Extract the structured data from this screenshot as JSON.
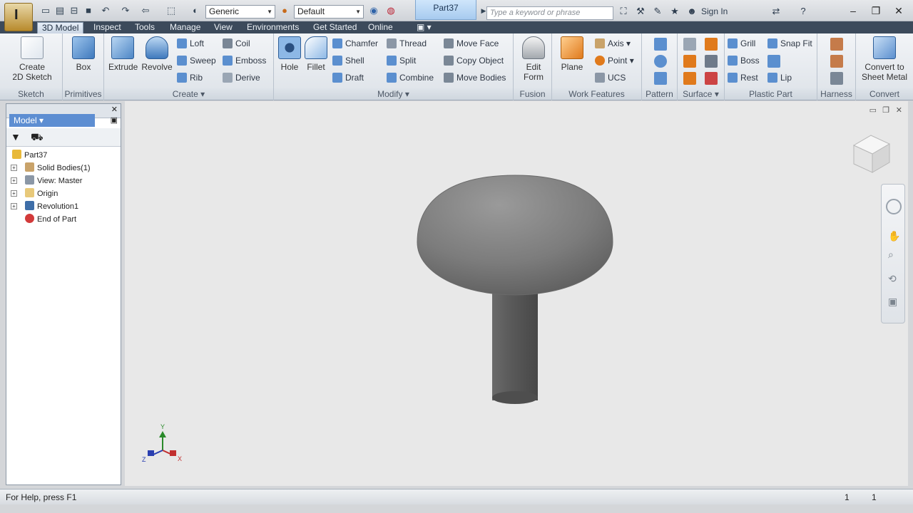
{
  "titlebar": {
    "material_combo": "Generic",
    "appearance_combo": "Default",
    "document_tab": "Part37",
    "search_placeholder": "Type a keyword or phrase",
    "sign_in": "Sign In"
  },
  "tabs": [
    "3D Model",
    "Inspect",
    "Tools",
    "Manage",
    "View",
    "Environments",
    "Get Started",
    "Online"
  ],
  "ribbon": {
    "sketch": {
      "label": "Sketch",
      "create_line1": "Create",
      "create_line2": "2D Sketch"
    },
    "primitives": {
      "label": "Primitives",
      "box": "Box"
    },
    "create": {
      "label": "Create",
      "extrude": "Extrude",
      "revolve": "Revolve",
      "loft": "Loft",
      "sweep": "Sweep",
      "rib": "Rib",
      "coil": "Coil",
      "emboss": "Emboss",
      "derive": "Derive"
    },
    "modify": {
      "label": "Modify",
      "hole": "Hole",
      "fillet": "Fillet",
      "chamfer": "Chamfer",
      "shell": "Shell",
      "draft": "Draft",
      "thread": "Thread",
      "split": "Split",
      "combine": "Combine",
      "move_face": "Move Face",
      "copy_object": "Copy Object",
      "move_bodies": "Move Bodies"
    },
    "fusion": {
      "label": "Fusion",
      "edit_line1": "Edit",
      "edit_line2": "Form"
    },
    "work_features": {
      "label": "Work Features",
      "plane": "Plane",
      "axis": "Axis",
      "point": "Point",
      "ucs": "UCS"
    },
    "pattern": {
      "label": "Pattern"
    },
    "surface": {
      "label": "Surface"
    },
    "plastic_part": {
      "label": "Plastic Part",
      "grill": "Grill",
      "boss": "Boss",
      "rest": "Rest",
      "snap_fit": "Snap Fit",
      "lip": "Lip"
    },
    "harness": {
      "label": "Harness"
    },
    "convert": {
      "label": "Convert",
      "line1": "Convert to",
      "line2": "Sheet Metal"
    }
  },
  "browser": {
    "title": "Model",
    "items": [
      {
        "label": "Part37"
      },
      {
        "label": "Solid Bodies(1)"
      },
      {
        "label": "View: Master"
      },
      {
        "label": "Origin"
      },
      {
        "label": "Revolution1"
      },
      {
        "label": "End of Part"
      }
    ]
  },
  "triad": {
    "y": "Y",
    "x": "X",
    "z": "Z"
  },
  "statusbar": {
    "help": "For Help, press F1",
    "count1": "1",
    "count2": "1"
  },
  "colors": {
    "tab_bar": "#3c4a5b",
    "active_tab": "#cbd6e4",
    "canvas": "#e8e8e8",
    "model_gray": "#7a7a7a",
    "browser_header": "#5d8ed2"
  }
}
